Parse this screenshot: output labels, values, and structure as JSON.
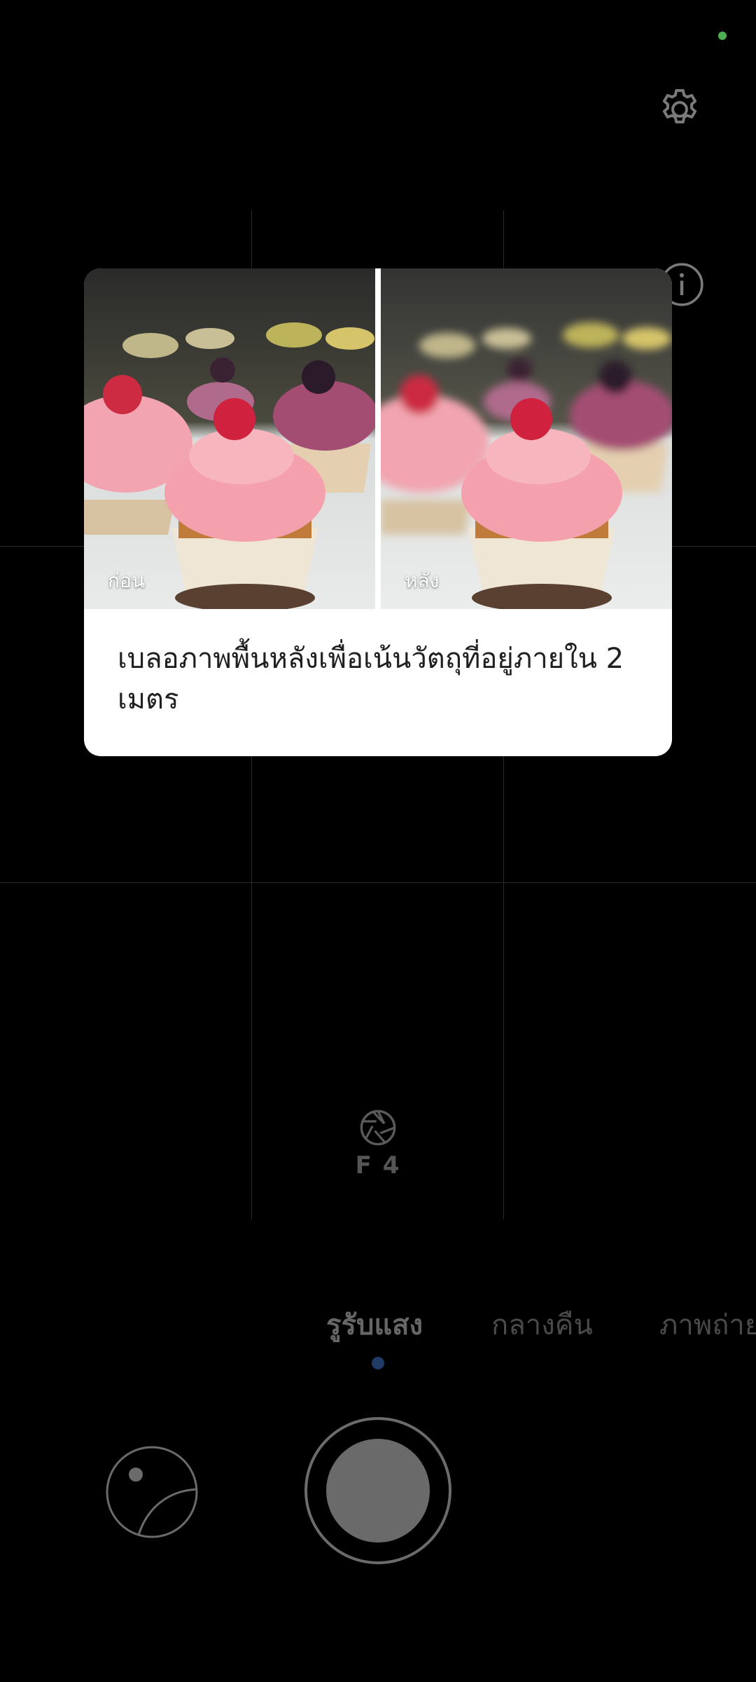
{
  "camera": {
    "privacy_dot_color": "#4caf50",
    "settings_icon": "gear-icon",
    "info_icon": "info-icon"
  },
  "viewfinder": {
    "aperture_icon": "aperture-icon",
    "aperture_value": "F 4"
  },
  "modes": {
    "items": [
      {
        "label": "รูรับแสง",
        "active": true
      },
      {
        "label": "กลางคืน",
        "active": false
      },
      {
        "label": "ภาพถ่าย",
        "active": false
      }
    ],
    "indicator_color": "#1f3b66"
  },
  "tip_card": {
    "before_label": "ก่อน",
    "after_label": "หลัง",
    "description": "เบลอภาพพื้นหลังเพื่อเน้นวัตถุที่อยู่ภายใน 2 เมตร"
  },
  "controls": {
    "gallery_icon": "gallery-thumbnail-icon",
    "shutter": "shutter-button"
  }
}
